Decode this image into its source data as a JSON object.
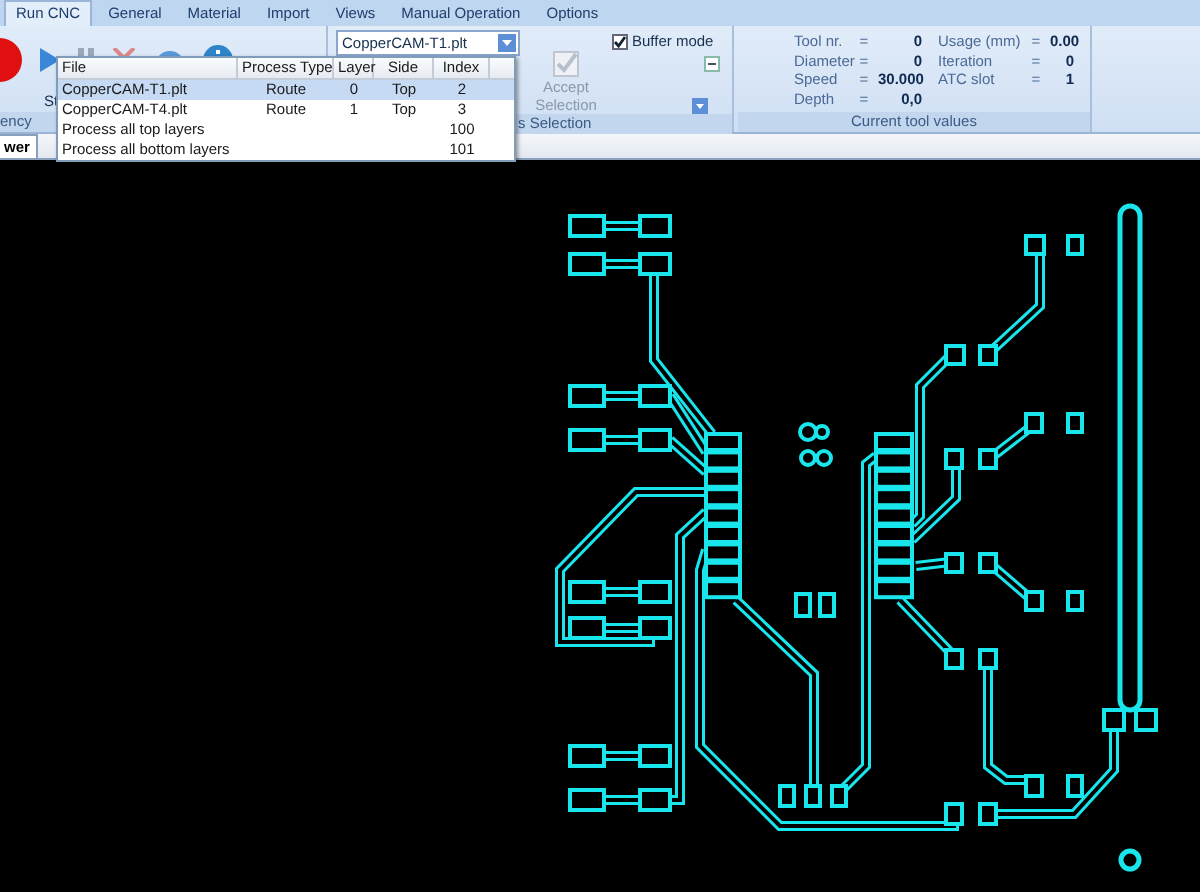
{
  "menu_tabs": [
    {
      "label": "Run CNC",
      "selected": true
    },
    {
      "label": "General",
      "selected": false
    },
    {
      "label": "Material",
      "selected": false
    },
    {
      "label": "Import",
      "selected": false
    },
    {
      "label": "Views",
      "selected": false
    },
    {
      "label": "Manual Operation",
      "selected": false
    },
    {
      "label": "Options",
      "selected": false
    }
  ],
  "ribbon": {
    "emergency_label": "ency",
    "start_label": "St",
    "file_select": {
      "value": "CopperCAM-T1.plt"
    },
    "accept_button": {
      "label": "Accept Selection",
      "disabled": true
    },
    "buffer_mode": {
      "label": "Buffer mode",
      "checked": true
    },
    "selection_group_label": "s Selection",
    "tool_values": {
      "title": "Current tool values",
      "items": [
        {
          "label": "Tool nr.",
          "eq": "=",
          "value": "0"
        },
        {
          "label": "Diameter",
          "eq": "=",
          "value": "0"
        },
        {
          "label": "Speed",
          "eq": "=",
          "value": "30.000"
        },
        {
          "label": "Depth",
          "eq": "=",
          "value": "0,0"
        },
        {
          "label": "Usage (mm)",
          "eq": "=",
          "value": "0.00"
        },
        {
          "label": "Iteration",
          "eq": "=",
          "value": "0"
        },
        {
          "label": "ATC slot",
          "eq": "=",
          "value": "1"
        }
      ]
    }
  },
  "document_tab": {
    "label": "wer"
  },
  "file_dropdown": {
    "columns": [
      "File",
      "Process Type",
      "Layer",
      "Side",
      "Index"
    ],
    "rows": [
      {
        "cells": [
          "CopperCAM-T1.plt",
          "Route",
          "0",
          "Top",
          "2"
        ],
        "selected": true
      },
      {
        "cells": [
          "CopperCAM-T4.plt",
          "Route",
          "1",
          "Top",
          "3"
        ],
        "selected": false
      },
      {
        "cells": [
          "Process all top layers",
          "",
          "",
          "",
          "100"
        ],
        "selected": false
      },
      {
        "cells": [
          "Process all bottom layers",
          "",
          "",
          "",
          "101"
        ],
        "selected": false
      }
    ]
  }
}
